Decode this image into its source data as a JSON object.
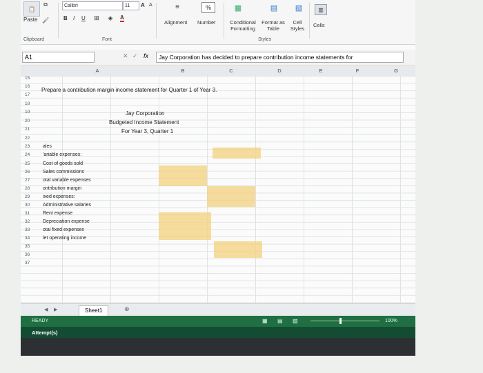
{
  "ribbon": {
    "paste_label": "Paste",
    "clipboard_label": "Clipboard",
    "font_name": "Calibri",
    "font_size": "11",
    "grow_label": "A",
    "shrink_label": "A",
    "bold": "B",
    "italic": "I",
    "underline": "U",
    "font_color_label": "A",
    "font_label": "Font",
    "alignment_label": "Alignment",
    "number_label": "Number",
    "percent": "%",
    "conditional_label": "Conditional Formatting",
    "format_table_label": "Format as Table",
    "cell_styles_label": "Cell Styles",
    "cells_label": "Cells",
    "styles_label": "Styles"
  },
  "formula_bar": {
    "name_box": "A1",
    "fx": "fx",
    "content": "Jay Corporation has decided to prepare contribution income statements for"
  },
  "columns": [
    "A",
    "B",
    "C",
    "D",
    "E",
    "F",
    "G"
  ],
  "rows": [
    "15",
    "16",
    "17",
    "18",
    "19",
    "20",
    "21",
    "22",
    "23",
    "24",
    "25",
    "26",
    "27",
    "28",
    "29",
    "30",
    "31",
    "32",
    "33",
    "34",
    "35",
    "36",
    "37"
  ],
  "cells": {
    "instruction": "Prepare a contribution margin income statement for Quarter 1 of Year 3.",
    "company": "Jay Corporation",
    "statement": "Budgeted Income Statement",
    "period": "For Year 3, Quarter 1",
    "sales": "ales",
    "variable_expenses": "'ariable expenses:",
    "cogs": "Cost of goods sold",
    "sales_commissions": "Sales commissions",
    "total_variable": "otal variable expenses",
    "contribution_margin": "ontribution margin",
    "fixed_expenses": "ixed expenses:",
    "admin_salaries": "Administrative salaries",
    "rent": "Rent expense",
    "depreciation": "Depreciation expense",
    "total_fixed": "otal fixed expenses",
    "net_operating_income": "let operating income"
  },
  "sheet_tab": "Sheet1",
  "status": {
    "ready": "READY",
    "zoom": "100%"
  },
  "attempts_label": "Attempt(s)"
}
